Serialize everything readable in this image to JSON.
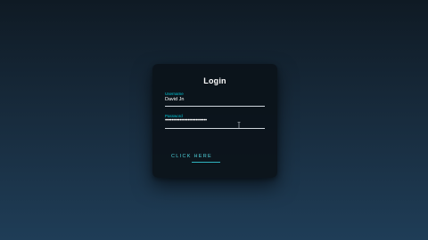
{
  "login": {
    "title": "Login",
    "username": {
      "label": "Username",
      "value": "David Jn"
    },
    "password": {
      "label": "Password",
      "masked_value": "••••••••••••••••••••••••••"
    },
    "submit_label": "CLICK HERE"
  },
  "colors": {
    "accent": "#00c8d8",
    "card_background": "#0b1219",
    "text": "#ffffff"
  },
  "icons": {
    "cursor": "text-cursor-icon"
  }
}
